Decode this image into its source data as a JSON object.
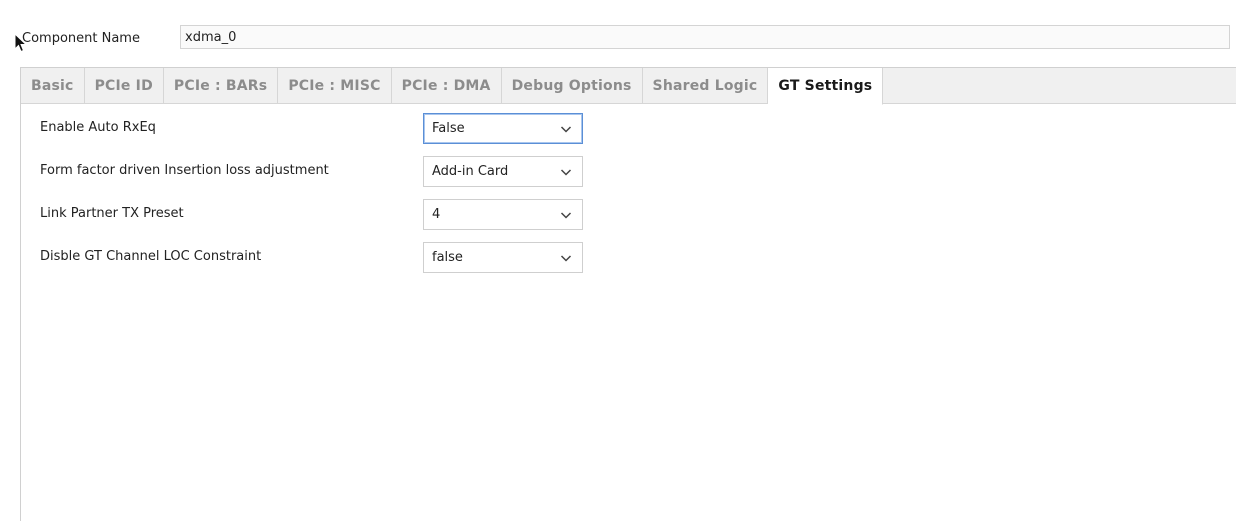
{
  "component": {
    "label": "Component Name",
    "value": "xdma_0"
  },
  "tabs": [
    {
      "label": "Basic"
    },
    {
      "label": "PCIe ID"
    },
    {
      "label": "PCIe : BARs"
    },
    {
      "label": "PCIe : MISC"
    },
    {
      "label": "PCIe : DMA"
    },
    {
      "label": "Debug Options"
    },
    {
      "label": "Shared Logic"
    },
    {
      "label": "GT Settings"
    }
  ],
  "active_tab": "GT Settings",
  "settings": [
    {
      "label": "Enable Auto RxEq",
      "value": "False"
    },
    {
      "label": "Form factor driven Insertion loss adjustment",
      "value": "Add-in Card"
    },
    {
      "label": "Link Partner TX Preset",
      "value": "4"
    },
    {
      "label": "Disble GT Channel LOC Constraint",
      "value": "false"
    }
  ],
  "colors": {
    "focus_border": "#5b8fd6",
    "tab_strip": "#f0f0f0",
    "inactive_tab_text": "#8c8c8c"
  },
  "icons": {
    "cursor": "mouse-pointer-icon",
    "dropdown": "chevron-down-icon"
  }
}
